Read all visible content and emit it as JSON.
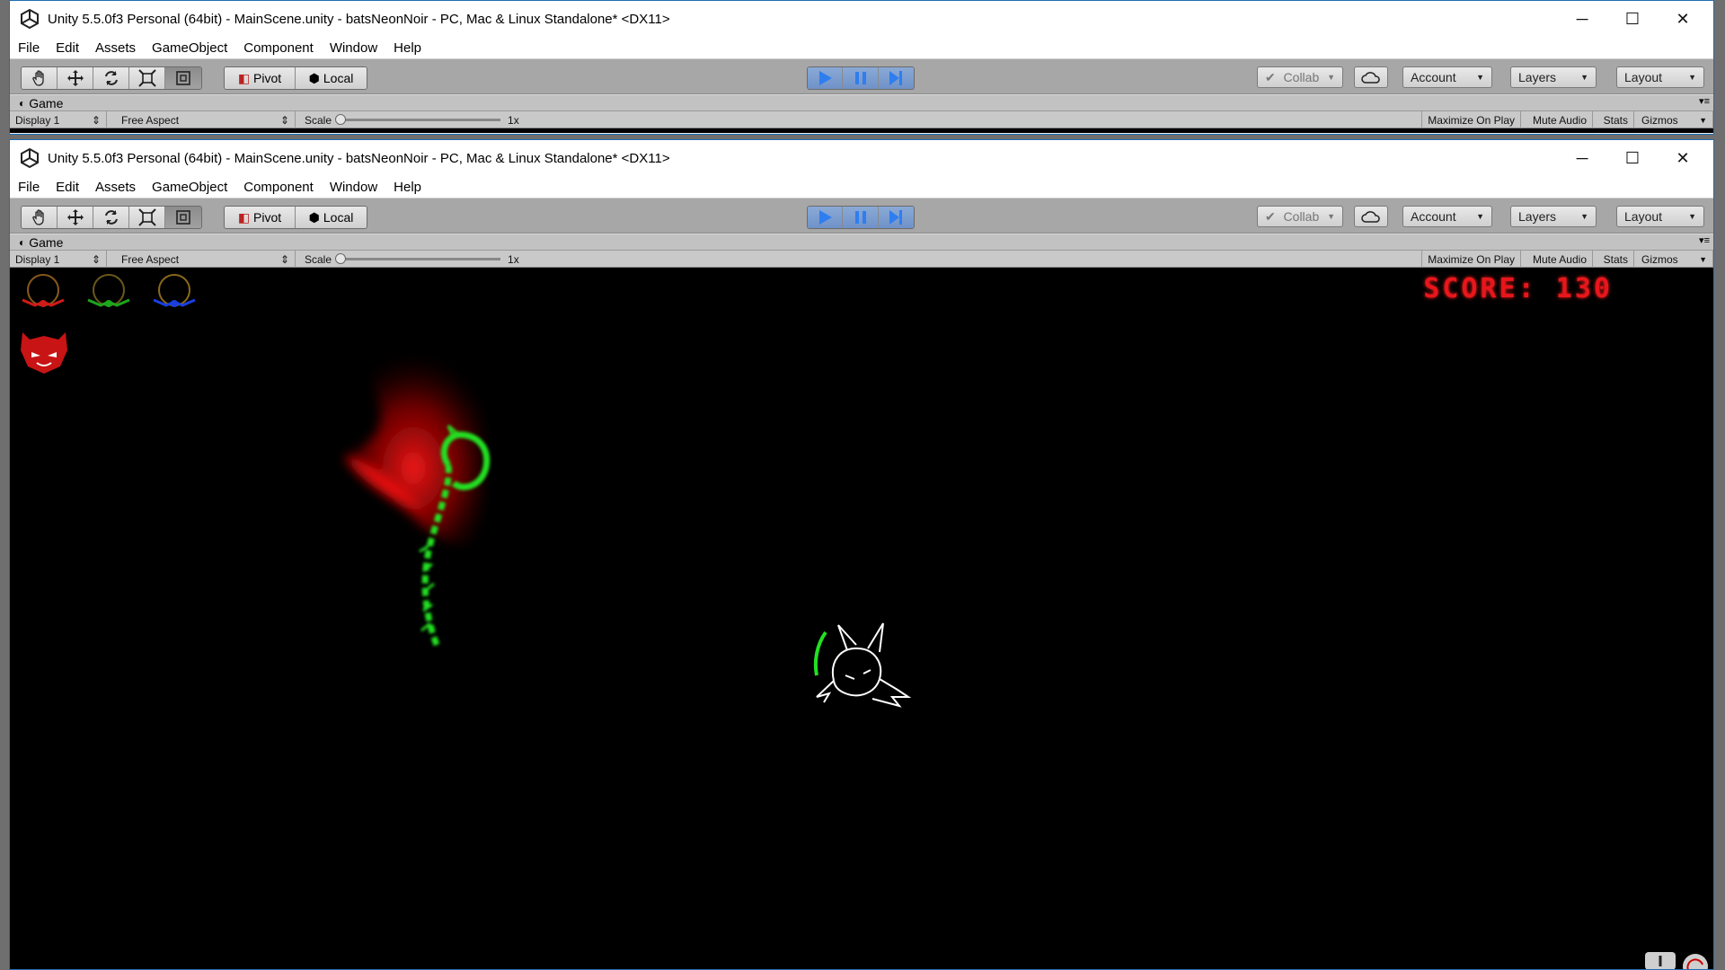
{
  "window": {
    "title": "Unity 5.5.0f3 Personal (64bit) - MainScene.unity - batsNeonNoir - PC, Mac & Linux Standalone* <DX11>",
    "minimize_glyph": "─",
    "maximize_glyph": "☐",
    "close_glyph": "✕"
  },
  "menu": [
    "File",
    "Edit",
    "Assets",
    "GameObject",
    "Component",
    "Window",
    "Help"
  ],
  "toolbar": {
    "pivot_label": "Pivot",
    "local_label": "Local",
    "collab_label": "Collab",
    "account_label": "Account",
    "layers_label": "Layers",
    "layout_label": "Layout",
    "play_active": true
  },
  "game": {
    "tab_label": "Game",
    "display_label": "Display 1",
    "aspect_label": "Free Aspect",
    "scale_label": "Scale",
    "scale_value": "1x",
    "maximize_label": "Maximize On Play",
    "mute_label": "Mute Audio",
    "stats_label": "Stats",
    "gizmos_label": "Gizmos"
  },
  "hud": {
    "score_text": "SCORE: 130",
    "ring_colors": [
      "#d11a1a",
      "#1ca61c",
      "#1a3fe0"
    ],
    "lives": 1
  },
  "colors": {
    "play_blue": "#2f7ef0",
    "score_red": "#e8161b",
    "serpent_green": "#22e022",
    "flame_red": "#d00000"
  }
}
